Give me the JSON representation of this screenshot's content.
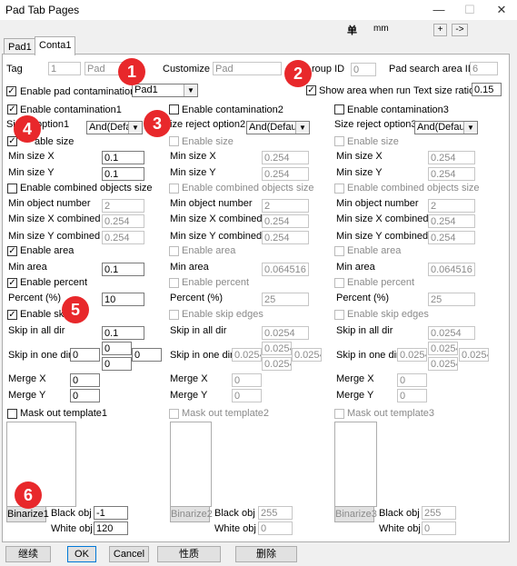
{
  "window": {
    "title": "Pad Tab Pages",
    "minimize": "—",
    "maximize": "☐",
    "close": "✕"
  },
  "topbar": {
    "unit_label": "单",
    "unit_value": "mm",
    "plus_btn": "+",
    "arrow_btn": "->"
  },
  "tabs": [
    "Pad1",
    "Conta1"
  ],
  "header": {
    "tag_label": "Tag",
    "tag_value": "1",
    "tag_name": "Pad",
    "customize_label": "Customize",
    "customize_value": "Pad",
    "group_id_label": "roup ID",
    "group_id_value": "0",
    "pad_search_label": "Pad search area ID",
    "pad_search_value": "6",
    "enable_pad_contam": "Enable pad contamination",
    "pad_select": "Pad1",
    "show_area": "Show area when run",
    "text_size_label": "Text size ratio",
    "text_size_value": "0.15"
  },
  "col1": {
    "enable_contam": "Enable contamination1",
    "size_reject_label": "Si  ject option1",
    "size_reject_value": "And(Default)",
    "enable_size": "able size",
    "min_x_label": "Min size X",
    "min_x": "0.1",
    "min_y_label": "Min size Y",
    "min_y": "0.1",
    "enable_combined": "Enable combined objects size",
    "min_obj_label": "Min object number",
    "min_obj": "2",
    "min_x_comb_label": "Min size X combined",
    "min_x_comb": "0.254",
    "min_y_comb_label": "Min size Y combined",
    "min_y_comb": "0.254",
    "enable_area": "Enable area",
    "min_area_label": "Min area",
    "min_area": "0.1",
    "enable_percent": "Enable percent",
    "percent_label": "Percent (%)",
    "percent": "10",
    "enable_skip": "Enable skip",
    "skip_all_label": "Skip in all dir",
    "skip_all": "0.1",
    "skip_one_label": "Skip in one dir",
    "skip_l": "0",
    "skip_t": "0",
    "skip_b": "0",
    "skip_r": "0",
    "merge_x_label": "Merge X",
    "merge_x": "0",
    "merge_y_label": "Merge Y",
    "merge_y": "0",
    "mask_label": "Mask out template1",
    "binarize": "Binarize1",
    "black_label": "Black obj",
    "black": "-1",
    "white_label": "White obj",
    "white": "120"
  },
  "col2": {
    "enable_contam": "Enable contamination2",
    "size_reject_label": "ize reject option2",
    "size_reject_value": "And(Default)",
    "enable_size": "Enable size",
    "min_x_label": "Min size X",
    "min_x": "0.254",
    "min_y_label": "Min size Y",
    "min_y": "0.254",
    "enable_combined": "Enable combined objects size",
    "min_obj_label": "Min object number",
    "min_obj": "2",
    "min_x_comb_label": "Min size X combined",
    "min_x_comb": "0.254",
    "min_y_comb_label": "Min size Y combined",
    "min_y_comb": "0.254",
    "enable_area": "Enable area",
    "min_area_label": "Min area",
    "min_area": "0.064516",
    "enable_percent": "Enable percent",
    "percent_label": "Percent (%)",
    "percent": "25",
    "enable_skip": "Enable skip edges",
    "skip_all_label": "Skip in all dir",
    "skip_all": "0.0254",
    "skip_one_label": "Skip in one dir",
    "skip_l": "0.0254",
    "skip_t": "0.0254",
    "skip_b": "0.0254",
    "skip_r": "0.0254",
    "merge_x_label": "Merge X",
    "merge_x": "0",
    "merge_y_label": "Merge Y",
    "merge_y": "0",
    "mask_label": "Mask out template2",
    "binarize": "Binarize2",
    "black_label": "Black obj",
    "black": "255",
    "white_label": "White obj",
    "white": "0"
  },
  "col3": {
    "enable_contam": "Enable contamination3",
    "size_reject_label": "Size reject option3",
    "size_reject_value": "And(Default)",
    "enable_size": "Enable size",
    "min_x_label": "Min size X",
    "min_x": "0.254",
    "min_y_label": "Min size Y",
    "min_y": "0.254",
    "enable_combined": "Enable combined objects size",
    "min_obj_label": "Min object number",
    "min_obj": "2",
    "min_x_comb_label": "Min size X combined",
    "min_x_comb": "0.254",
    "min_y_comb_label": "Min size Y combined",
    "min_y_comb": "0.254",
    "enable_area": "Enable area",
    "min_area_label": "Min area",
    "min_area": "0.064516",
    "enable_percent": "Enable percent",
    "percent_label": "Percent (%)",
    "percent": "25",
    "enable_skip": "Enable skip edges",
    "skip_all_label": "Skip in all dir",
    "skip_all": "0.0254",
    "skip_one_label": "Skip in one dir",
    "skip_l": "0.0254",
    "skip_t": "0.0254",
    "skip_b": "0.0254",
    "skip_r": "0.0254",
    "merge_x_label": "Merge X",
    "merge_x": "0",
    "merge_y_label": "Merge Y",
    "merge_y": "0",
    "mask_label": "Mask out template3",
    "binarize": "Binarize3",
    "black_label": "Black obj",
    "black": "255",
    "white_label": "White obj",
    "white": "0"
  },
  "footer": {
    "continue": "继续",
    "ok": "OK",
    "cancel": "Cancel",
    "property": "性质",
    "delete": "删除"
  },
  "badges": [
    "1",
    "2",
    "3",
    "4",
    "5",
    "6"
  ],
  "colors": {
    "badge": "#e8282b"
  }
}
